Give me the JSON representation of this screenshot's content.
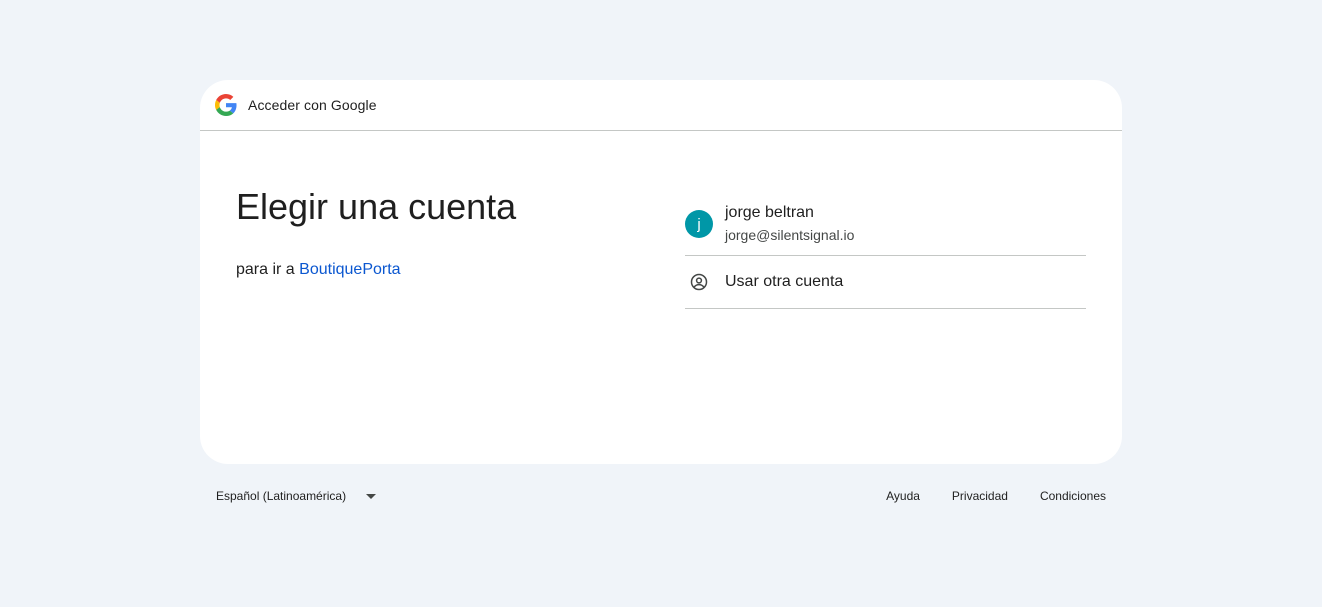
{
  "header": {
    "title": "Acceder con Google"
  },
  "main": {
    "title": "Elegir una cuenta",
    "subtitle_prefix": "para ir a",
    "app_name": "BoutiquePorta"
  },
  "accounts": [
    {
      "initial": "j",
      "name": "jorge beltran",
      "email": "jorge@silentsignal.io",
      "avatar_color": "#0097a7"
    }
  ],
  "other_account": {
    "label": "Usar otra cuenta",
    "icon": "account-circle-icon"
  },
  "footer": {
    "language": "Español (Latinoamérica)",
    "links": [
      "Ayuda",
      "Privacidad",
      "Condiciones"
    ]
  },
  "colors": {
    "background": "#f0f4f9",
    "link": "#0b57d0",
    "divider": "#c4c7c5"
  }
}
